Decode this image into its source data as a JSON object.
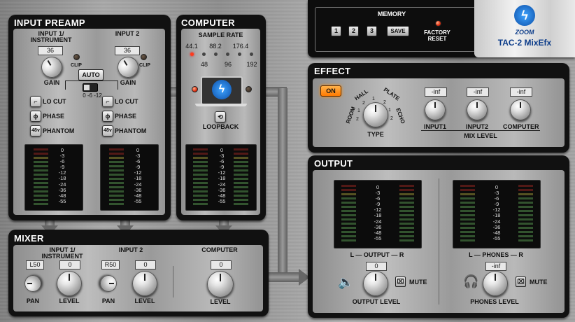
{
  "memory": {
    "title": "MEMORY",
    "buttons": [
      "1",
      "2",
      "3"
    ],
    "save": "SAVE",
    "factory_reset": "FACTORY\nRESET"
  },
  "logo": {
    "brand": "ZOOM",
    "product": "TAC-2 MixEfx"
  },
  "input_preamp": {
    "title": "INPUT PREAMP",
    "ch1": {
      "name": "INPUT 1/\nINSTRUMENT",
      "value": "36",
      "gain": "GAIN",
      "clip": "CLIP"
    },
    "ch2": {
      "name": "INPUT 2",
      "value": "36",
      "gain": "GAIN",
      "clip": "CLIP"
    },
    "auto": "AUTO",
    "auto_scale": "0 -6 -12",
    "locut": "LO CUT",
    "phase": "PHASE",
    "phantom": "PHANTOM",
    "phase_symbol": "ϕ",
    "phantom_symbol": "48v"
  },
  "computer": {
    "title": "COMPUTER",
    "sample_rate": "SAMPLE RATE",
    "rates_top": [
      "44.1",
      "88.2",
      "176.4"
    ],
    "rates_bottom": [
      "48",
      "96",
      "192"
    ],
    "loopback": "LOOPBACK"
  },
  "meter_scale": [
    "0",
    "-3",
    "-6",
    "-9",
    "-12",
    "-18",
    "-24",
    "-36",
    "-48",
    "-55"
  ],
  "mixer": {
    "title": "MIXER",
    "ch1": {
      "name": "INPUT 1/\nINSTRUMENT",
      "pan_value": "L50",
      "level_value": "0",
      "pan": "PAN",
      "level": "LEVEL"
    },
    "ch2": {
      "name": "INPUT 2",
      "pan_value": "R50",
      "level_value": "0",
      "pan": "PAN",
      "level": "LEVEL"
    },
    "computer": {
      "name": "COMPUTER",
      "level_value": "0",
      "level": "LEVEL"
    }
  },
  "effect": {
    "title": "EFFECT",
    "on": "ON",
    "types": [
      "ROOM",
      "HALL",
      "PLATE",
      "ECHO"
    ],
    "type_numbers": [
      "2",
      "1",
      "2",
      "1",
      "2",
      "1",
      "2"
    ],
    "type_label": "TYPE",
    "inputs": [
      {
        "name": "INPUT1",
        "value": "-inf"
      },
      {
        "name": "INPUT2",
        "value": "-inf"
      },
      {
        "name": "COMPUTER",
        "value": "-inf"
      }
    ],
    "mix_level": "MIX LEVEL"
  },
  "output": {
    "title": "OUTPUT",
    "out_label": "L — OUTPUT — R",
    "phones_label": "L — PHONES — R",
    "output_value": "0",
    "output_level": "OUTPUT LEVEL",
    "phones_value": "-inf",
    "phones_level": "PHONES LEVEL",
    "mute": "MUTE",
    "mute2": "MUTE"
  },
  "colors": {
    "panel": "#111111",
    "led_on": "#ff3b1c",
    "effect_on": "#ff8a00"
  }
}
